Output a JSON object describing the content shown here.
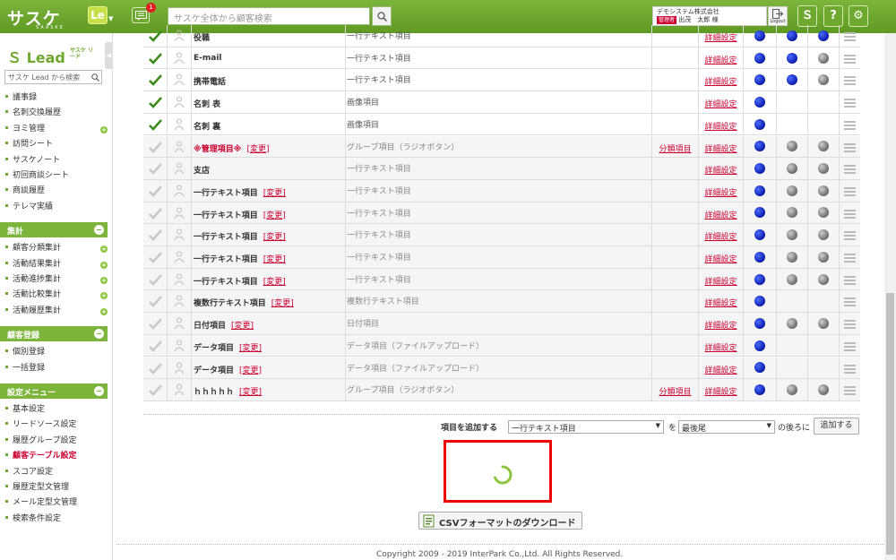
{
  "header": {
    "logo": "サスケ",
    "logo_sub": "SAASKE",
    "app_badge": "Le",
    "message_count": "1",
    "search_placeholder": "サスケ全体から顧客検索",
    "company": "デモシステム株式会社",
    "role": "管理者",
    "user": "出茂　太郎 様",
    "logout": "Logout",
    "icons": [
      "saaske-icon",
      "help-icon",
      "settings-icon"
    ],
    "brand_color": "#6fa82e"
  },
  "sidebar": {
    "logo": "Lead",
    "logo_kana": "サスケ リード",
    "search_placeholder": "サスケ Lead から検索",
    "top_items": [
      "議事録",
      "名刺交換履歴",
      "ヨミ管理",
      "訪問シート",
      "サスケノート",
      "初回商談シート",
      "商談履歴",
      "テレマ実績"
    ],
    "sections": [
      {
        "title": "集計",
        "items": [
          "顧客分類集計",
          "活動結果集計",
          "活動進捗集計",
          "活動比較集計",
          "活動履歴集計"
        ]
      },
      {
        "title": "顧客登録",
        "items": [
          "個別登録",
          "一括登録"
        ]
      },
      {
        "title": "設定メニュー",
        "items": [
          "基本設定",
          "リードソース設定",
          "履歴グループ設定",
          "顧客テーブル設定",
          "スコア設定",
          "履歴定型文管理",
          "メール定型文管理",
          "検索条件設定"
        ]
      }
    ],
    "active_item": "顧客テーブル設定"
  },
  "table": {
    "detail_label": "詳細設定",
    "change_label": "[変更]",
    "rows": [
      {
        "name": "役職",
        "type": "一行テキスト項目",
        "cat": "",
        "checked": true,
        "dots": [
          "blue",
          "blue",
          "blue"
        ],
        "change": false
      },
      {
        "name": "E-mail",
        "type": "一行テキスト項目",
        "cat": "",
        "checked": true,
        "dots": [
          "blue",
          "blue",
          "grey"
        ],
        "change": false
      },
      {
        "name": "携帯電話",
        "type": "一行テキスト項目",
        "cat": "",
        "checked": true,
        "dots": [
          "blue",
          "blue",
          "grey"
        ],
        "change": false
      },
      {
        "name": "名刺 表",
        "type": "画像項目",
        "cat": "",
        "checked": true,
        "dots": [
          "blue"
        ],
        "change": false
      },
      {
        "name": "名刺 裏",
        "type": "画像項目",
        "cat": "",
        "checked": true,
        "dots": [
          "blue"
        ],
        "change": false
      },
      {
        "name": "※管理項目※",
        "type": "グループ項目（ラジオボタン）",
        "cat": "分類項目",
        "checked": false,
        "dots": [
          "blue",
          "grey",
          "grey"
        ],
        "change": true,
        "red": true
      },
      {
        "name": "支店",
        "type": "一行テキスト項目",
        "cat": "",
        "checked": false,
        "dots": [
          "blue",
          "grey",
          "grey"
        ],
        "change": false
      },
      {
        "name": "一行テキスト項目",
        "type": "一行テキスト項目",
        "cat": "",
        "checked": false,
        "dots": [
          "blue",
          "grey",
          "grey"
        ],
        "change": true
      },
      {
        "name": "一行テキスト項目",
        "type": "一行テキスト項目",
        "cat": "",
        "checked": false,
        "dots": [
          "blue",
          "grey",
          "grey"
        ],
        "change": true
      },
      {
        "name": "一行テキスト項目",
        "type": "一行テキスト項目",
        "cat": "",
        "checked": false,
        "dots": [
          "blue",
          "grey",
          "grey"
        ],
        "change": true
      },
      {
        "name": "一行テキスト項目",
        "type": "一行テキスト項目",
        "cat": "",
        "checked": false,
        "dots": [
          "blue",
          "grey",
          "grey"
        ],
        "change": true
      },
      {
        "name": "一行テキスト項目",
        "type": "一行テキスト項目",
        "cat": "",
        "checked": false,
        "dots": [
          "blue",
          "grey",
          "grey"
        ],
        "change": true
      },
      {
        "name": "複数行テキスト項目",
        "type": "複数行テキスト項目",
        "cat": "",
        "checked": false,
        "dots": [
          "blue"
        ],
        "change": true
      },
      {
        "name": "日付項目",
        "type": "日付項目",
        "cat": "",
        "checked": false,
        "dots": [
          "blue",
          "grey",
          "grey"
        ],
        "change": true
      },
      {
        "name": "データ項目",
        "type": "データ項目（ファイルアップロード）",
        "cat": "",
        "checked": false,
        "dots": [
          "blue"
        ],
        "change": true
      },
      {
        "name": "データ項目",
        "type": "データ項目（ファイルアップロード）",
        "cat": "",
        "checked": false,
        "dots": [
          "blue"
        ],
        "change": true
      },
      {
        "name": "ｈｈｈｈｈ",
        "type": "グループ項目（ラジオボタン）",
        "cat": "分類項目",
        "checked": false,
        "dots": [
          "blue",
          "grey",
          "grey"
        ],
        "change": true
      }
    ]
  },
  "add": {
    "label": "項目を追加する",
    "type_value": "一行テキスト項目",
    "wo": "を",
    "position_value": "最後尾",
    "after": "の後ろに",
    "button": "追加する"
  },
  "csv_button": "CSVフォーマットのダウンロード",
  "footer": "Copyright 2009 - 2019 InterPark Co.,Ltd. All Rights Reserved."
}
